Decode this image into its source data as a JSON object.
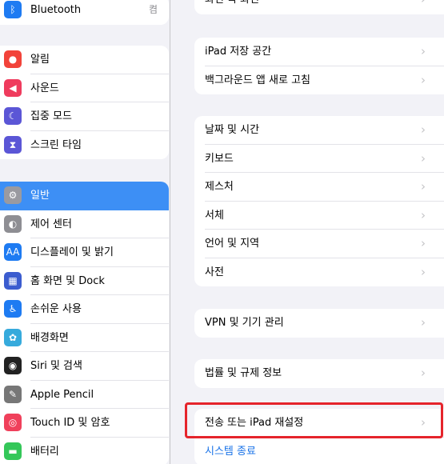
{
  "sidebar": {
    "group0": [
      {
        "label": "Bluetooth",
        "value": "켬",
        "icon": "bluetooth-icon",
        "glyph": "ᛒ",
        "color": "#1e7bf2"
      }
    ],
    "group1": [
      {
        "label": "알림",
        "icon": "bell-icon",
        "glyph": "●",
        "color": "#f2433a"
      },
      {
        "label": "사운드",
        "icon": "speaker-icon",
        "glyph": "◀",
        "color": "#ef3b5d"
      },
      {
        "label": "집중 모드",
        "icon": "moon-icon",
        "glyph": "☾",
        "color": "#5b56d6"
      },
      {
        "label": "스크린 타임",
        "icon": "hourglass-icon",
        "glyph": "⧗",
        "color": "#5b56d6"
      }
    ],
    "group2": [
      {
        "label": "일반",
        "icon": "gear-icon",
        "glyph": "⚙",
        "color": "#8e8e93",
        "selected": true
      },
      {
        "label": "제어 센터",
        "icon": "toggles-icon",
        "glyph": "◐",
        "color": "#8e8e93"
      },
      {
        "label": "디스플레이 및 밝기",
        "icon": "text-size-icon",
        "glyph": "AA",
        "color": "#1e7bf2"
      },
      {
        "label": "홈 화면 및 Dock",
        "icon": "home-grid-icon",
        "glyph": "▦",
        "color": "#3b5ccf"
      },
      {
        "label": "손쉬운 사용",
        "icon": "accessibility-icon",
        "glyph": "♿",
        "color": "#1e7bf2"
      },
      {
        "label": "배경화면",
        "icon": "flower-icon",
        "glyph": "✿",
        "color": "#36aadc"
      },
      {
        "label": "Siri 및 검색",
        "icon": "siri-icon",
        "glyph": "◉",
        "color": "#222"
      },
      {
        "label": "Apple Pencil",
        "icon": "pencil-icon",
        "glyph": "✎",
        "color": "#777"
      },
      {
        "label": "Touch ID 및 암호",
        "icon": "fingerprint-icon",
        "glyph": "◎",
        "color": "#f0405b"
      },
      {
        "label": "배터리",
        "icon": "battery-icon",
        "glyph": "▬",
        "color": "#34c759"
      }
    ]
  },
  "detail": {
    "group0": [
      {
        "label": "화면 속 화면"
      }
    ],
    "group1": [
      {
        "label": "iPad 저장 공간"
      },
      {
        "label": "백그라운드 앱 새로 고침"
      }
    ],
    "group2": [
      {
        "label": "날짜 및 시간"
      },
      {
        "label": "키보드"
      },
      {
        "label": "제스처"
      },
      {
        "label": "서체"
      },
      {
        "label": "언어 및 지역"
      },
      {
        "label": "사전"
      }
    ],
    "group3": [
      {
        "label": "VPN 및 기기 관리"
      }
    ],
    "group4": [
      {
        "label": "법률 및 규제 정보"
      }
    ],
    "group5": [
      {
        "label": "전송 또는 iPad 재설정"
      },
      {
        "label": "시스템 종료",
        "style": "blue"
      }
    ],
    "chevron": "›"
  }
}
